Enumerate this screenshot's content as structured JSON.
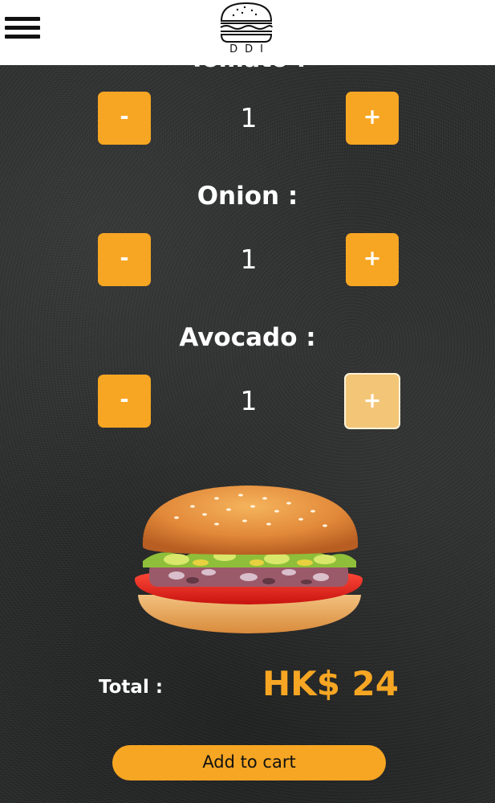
{
  "header": {
    "logo_text": "DDI"
  },
  "hidden_topping_label": "Tomato :",
  "toppings": [
    {
      "name": "",
      "minus": "-",
      "quantity": "1",
      "plus": "+"
    },
    {
      "name": "Onion :",
      "minus": "-",
      "quantity": "1",
      "plus": "+"
    },
    {
      "name": "Avocado :",
      "minus": "-",
      "quantity": "1",
      "plus": "+"
    }
  ],
  "total": {
    "label": "Total :",
    "value": "HK$ 24"
  },
  "add_to_cart_label": "Add to cart",
  "colors": {
    "accent": "#f6a623",
    "accent_active": "#f3c577",
    "background": "#2e2f2f",
    "header": "#ffffff"
  },
  "icons": [
    "hamburger-menu-icon",
    "burger-logo-icon"
  ]
}
